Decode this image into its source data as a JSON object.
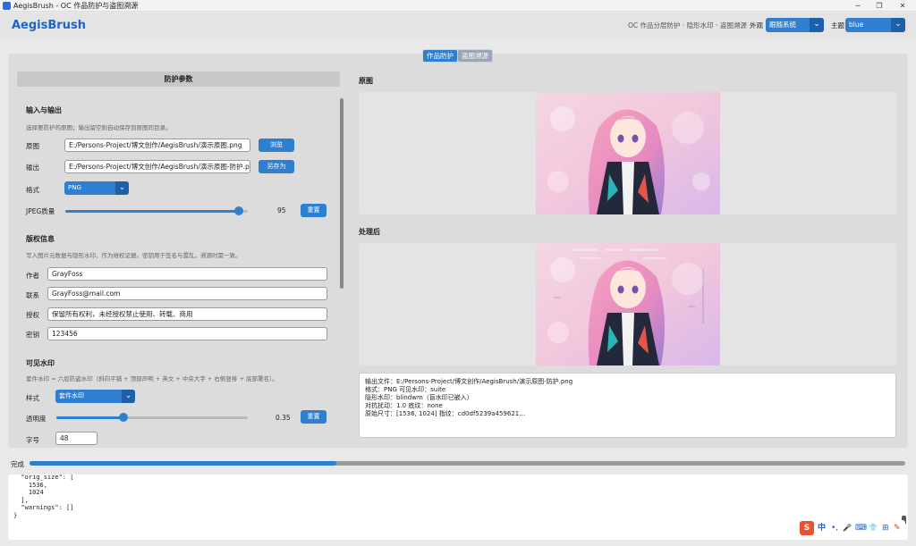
{
  "window": {
    "title": "AegisBrush - OC 作品防护与盗图溯源",
    "controls": [
      "─",
      "❐",
      "✕"
    ]
  },
  "header": {
    "brand": "AegisBrush",
    "subtitle": "OC 作品分层防护 · 隐形水印 · 盗图溯源",
    "appearance_label": "外观",
    "appearance_value": "跟随系统",
    "theme_label": "主题",
    "theme_value": "blue"
  },
  "tabs": [
    {
      "label": "作品防护",
      "active": true
    },
    {
      "label": "盗图溯源",
      "active": false
    }
  ],
  "left": {
    "heading": "防护参数",
    "io": {
      "title": "输入与输出",
      "desc": "选择要防护的原图；输出留空则自动保存到原图同目录。",
      "src_label": "原图",
      "src_value": "E:/Persons-Project/博文创作/AegisBrush/演示原图.png",
      "browse_label": "浏览",
      "out_label": "输出",
      "out_value": "E:/Persons-Project/博文创作/AegisBrush/演示原图-防护.png",
      "saveas_label": "另存为",
      "format_label": "格式",
      "format_value": "PNG",
      "jpeg_label": "JPEG质量",
      "jpeg_value": "95",
      "jpeg_fraction": 0.95,
      "reset_label": "重置"
    },
    "copyright": {
      "title": "版权信息",
      "desc": "写入图片元数据与隐形水印，作为维权证据。密钥用于签名与置乱，溯源时需一致。",
      "author_label": "作者",
      "author_value": "GrayFoss",
      "contact_label": "联系",
      "contact_value": "GrayFoss@mail.com",
      "license_label": "授权",
      "license_value": "保留所有权利，未经授权禁止使用、转载、商用",
      "key_label": "密钥",
      "key_value": "123456"
    },
    "visible": {
      "title": "可见水印",
      "desc": "套件水印 = 六层防盗水印（斜向平铺 + 顶部声明 + 英文 + 中央大字 + 右侧竖排 + 底部署名）。",
      "style_label": "样式",
      "style_value": "套件水印",
      "opacity_label": "透明度",
      "opacity_value": "0.35",
      "opacity_fraction": 0.35,
      "reset_label": "重置",
      "size_label": "字号",
      "size_value": "48"
    }
  },
  "right": {
    "original_label": "原图",
    "processed_label": "处理后",
    "info_lines": [
      "输出文件：E:/Persons-Project/博文创作/AegisBrush/演示原图-防护.png",
      "格式：PNG   可见水印：suite",
      "隐形水印：blindwm（盲水印已嵌入）",
      "对抗扰动：1.0   底纹：none",
      "原始尺寸：[1536, 1024]   指纹：cd0df5239a459621..."
    ]
  },
  "progress": {
    "label": "完成",
    "fraction": 0.35
  },
  "log": {
    "text": "  \"orig_size\": [\n    1536,\n    1024\n  ],\n  \"warnings\": []\n}"
  },
  "ime": {
    "glyphs": [
      "S",
      "中",
      "•,",
      "🎤",
      "⌨",
      "👕",
      "⊞",
      "✎"
    ]
  },
  "colors": {
    "accent": "#2f7fd0",
    "accent_dark": "#1e5fa8",
    "brand": "#1f66c4"
  }
}
